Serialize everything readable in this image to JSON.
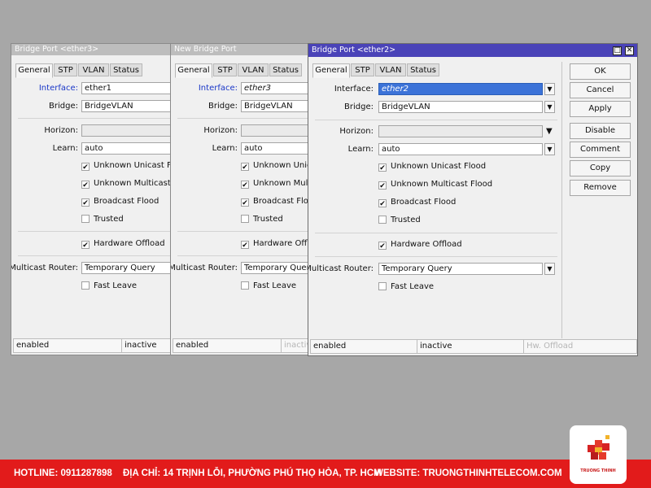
{
  "windows": [
    {
      "title": "Bridge Port <ether3>",
      "tabs": [
        "General",
        "STP",
        "VLAN",
        "Status"
      ],
      "interface_label": "Interface:",
      "interface_value": "ether1",
      "bridge_label": "Bridge:",
      "bridge_value": "BridgeVLAN",
      "horizon_label": "Horizon:",
      "learn_label": "Learn:",
      "learn_value": "auto",
      "unknown_unicast": "Unknown Unicast Flood",
      "unknown_multicast": "Unknown Multicast Flood",
      "broadcast": "Broadcast Flood",
      "trusted": "Trusted",
      "hw_offload": "Hardware Offload",
      "multicast_router_label": "Multicast Router:",
      "multicast_router_value": "Temporary Query",
      "fast_leave": "Fast Leave",
      "status_1": "enabled",
      "status_2": "inactive"
    },
    {
      "title": "New Bridge Port",
      "tabs": [
        "General",
        "STP",
        "VLAN",
        "Status"
      ],
      "interface_label": "Interface:",
      "interface_value": "ether3",
      "bridge_label": "Bridge:",
      "bridge_value": "BridgeVLAN",
      "horizon_label": "Horizon:",
      "learn_label": "Learn:",
      "learn_value": "auto",
      "unknown_unicast": "Unknown Unicast Flood",
      "unknown_multicast": "Unknown Multicast Flood",
      "broadcast": "Broadcast Flood",
      "trusted": "Trusted",
      "hw_offload": "Hardware Offload",
      "multicast_router_label": "Multicast Router:",
      "multicast_router_value": "Temporary Query",
      "fast_leave": "Fast Leave",
      "status_1": "enabled",
      "status_2": "inactive"
    },
    {
      "title": "Bridge Port <ether2>",
      "tabs": [
        "General",
        "STP",
        "VLAN",
        "Status"
      ],
      "interface_label": "Interface:",
      "interface_value": "ether2",
      "bridge_label": "Bridge:",
      "bridge_value": "BridgeVLAN",
      "horizon_label": "Horizon:",
      "learn_label": "Learn:",
      "learn_value": "auto",
      "unknown_unicast": "Unknown Unicast Flood",
      "unknown_multicast": "Unknown Multicast Flood",
      "broadcast": "Broadcast Flood",
      "trusted": "Trusted",
      "hw_offload": "Hardware Offload",
      "multicast_router_label": "Multicast Router:",
      "multicast_router_value": "Temporary Query",
      "fast_leave": "Fast Leave",
      "status_1": "enabled",
      "status_2": "inactive",
      "status_3": "Hw. Offload"
    }
  ],
  "buttons": {
    "ok": "OK",
    "cancel": "Cancel",
    "apply": "Apply",
    "disable": "Disable",
    "comment": "Comment",
    "copy": "Copy",
    "remove": "Remove"
  },
  "banner": {
    "hotline": "HOTLINE: 0911287898",
    "address": "ĐỊA CHỈ: 14 TRỊNH LỖI, PHƯỜNG PHÚ THỌ HÒA, TP. HCM",
    "website": "WEBSITE: TRUONGTHINHTELECOM.COM",
    "logo_text": "TRUONG THINH"
  },
  "colors": {
    "active_titlebar": "#4a43b8",
    "selection": "#3c73d8",
    "banner": "#e21b1b"
  },
  "checked": {
    "unknown_unicast": true,
    "unknown_multicast": true,
    "broadcast": true,
    "trusted": false,
    "hw_offload": true,
    "fast_leave": false
  }
}
